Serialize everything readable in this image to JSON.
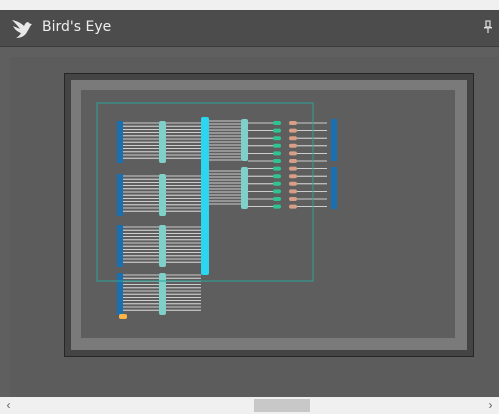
{
  "window": {
    "title": "Bird's Eye",
    "icon": "bird-icon",
    "pin_icon": "pin-icon"
  },
  "colors": {
    "panel_bg": "#5f5f5f",
    "titlebar_bg": "#4c4c4c",
    "accent_blue": "#1a6fb0",
    "accent_cyan": "#2ad6f0",
    "accent_teal": "#7ed0c8",
    "accent_green": "#30c490",
    "accent_salmon": "#d89f86",
    "viewport_outline": "#2aa49a",
    "block_orange": "#ffb648"
  },
  "scrollbar": {
    "left_arrow": "‹",
    "right_arrow": "›"
  }
}
